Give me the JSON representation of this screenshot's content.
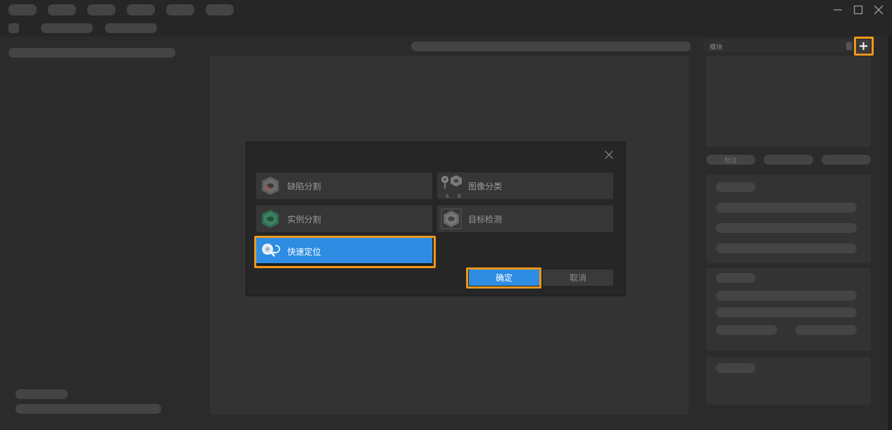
{
  "window": {
    "minimize_icon": "minimize-icon",
    "maximize_icon": "maximize-icon",
    "close_icon": "close-icon"
  },
  "right_panel": {
    "modules_label": "模块",
    "trash_icon": "trash-icon",
    "add_icon": "plus-icon",
    "tab_label": "标注"
  },
  "dialog": {
    "close_icon": "close-icon",
    "options": [
      {
        "label": "缺陷分割",
        "icon": "defect-segmentation-icon"
      },
      {
        "label": "图像分类",
        "icon": "image-classification-icon"
      },
      {
        "label": "实例分割",
        "icon": "instance-segmentation-icon"
      },
      {
        "label": "目标检测",
        "icon": "object-detection-icon"
      },
      {
        "label": "快速定位",
        "icon": "fast-positioning-icon"
      }
    ],
    "classification_sub": [
      "A",
      "B"
    ],
    "confirm_label": "确定",
    "cancel_label": "取消"
  },
  "colors": {
    "accent": "#2e8de3",
    "highlight": "#f0971a",
    "background": "#2b2b2b"
  }
}
